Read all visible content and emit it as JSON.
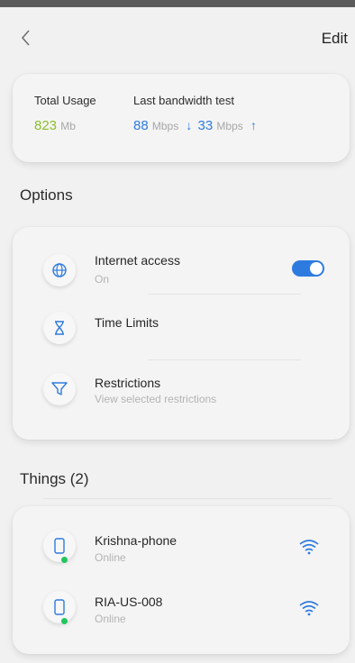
{
  "header": {
    "back_icon": "chevron-left-icon",
    "edit_label": "Edit"
  },
  "usage": {
    "total_label": "Total Usage",
    "total_value": "823",
    "total_unit": "Mb",
    "bandwidth_label": "Last bandwidth test",
    "download_value": "88",
    "download_unit": "Mbps",
    "upload_value": "33",
    "upload_unit": "Mbps",
    "colors": {
      "total": "#8dbf2a",
      "speed": "#2e7be0"
    }
  },
  "options": {
    "title": "Options",
    "items": [
      {
        "icon": "globe-icon",
        "title": "Internet access",
        "subtitle": "On",
        "toggle_on": true
      },
      {
        "icon": "hourglass-icon",
        "title": "Time Limits",
        "subtitle": ""
      },
      {
        "icon": "filter-icon",
        "title": "Restrictions",
        "subtitle": "View selected restrictions"
      }
    ]
  },
  "things": {
    "title": "Things (2)",
    "items": [
      {
        "icon": "phone-icon",
        "name": "Krishna-phone",
        "status": "Online",
        "signal_icon": "wifi-icon"
      },
      {
        "icon": "phone-icon",
        "name": "RIA-US-008",
        "status": "Online",
        "signal_icon": "wifi-icon"
      }
    ]
  },
  "accent_color": "#2e7be0"
}
